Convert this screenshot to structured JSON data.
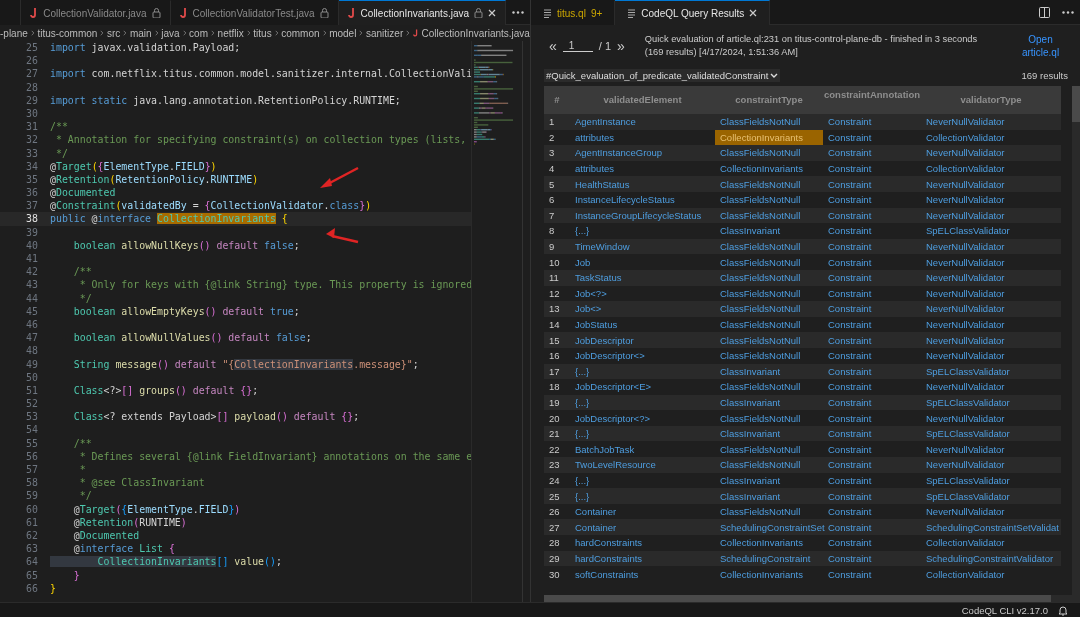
{
  "editor": {
    "tabs": [
      {
        "label": "CollectionValidator.java",
        "selected": false,
        "locked": true
      },
      {
        "label": "CollectionValidatorTest.java",
        "selected": false,
        "locked": true
      },
      {
        "label": "CollectionInvariants.java",
        "selected": true,
        "locked": true
      }
    ],
    "breadcrumb": [
      "-plane",
      "titus-common",
      "src",
      "main",
      "java",
      "com",
      "netflix",
      "titus",
      "common",
      "model",
      "sanitizer",
      "CollectionInvariants.java"
    ],
    "lines": [
      {
        "number": "25",
        "current": false,
        "tokens": [
          {
            "kind": "keyword",
            "text": "import"
          },
          {
            "kind": "plain",
            "text": " javax.validation.Payload;"
          }
        ]
      },
      {
        "number": "26",
        "current": false
      },
      {
        "number": "27",
        "current": false,
        "tokens": [
          {
            "kind": "keyword",
            "text": "import"
          },
          {
            "kind": "plain",
            "text": " com.netflix.titus.common.model.sanitizer.internal.CollectionVali"
          }
        ]
      },
      {
        "number": "28",
        "current": false
      },
      {
        "number": "29",
        "current": false,
        "tokens": [
          {
            "kind": "keyword",
            "text": "import"
          },
          {
            "kind": "keyword",
            "text": " static"
          },
          {
            "kind": "plain",
            "text": " java.lang.annotation.RetentionPolicy.RUNTIME;"
          }
        ]
      },
      {
        "number": "30",
        "current": false
      },
      {
        "number": "31",
        "current": false,
        "tokens": [
          {
            "kind": "comment",
            "text": "/**"
          }
        ]
      },
      {
        "number": "32",
        "current": false,
        "tokens": [
          {
            "kind": "comment",
            "text": " * Annotation for specifying constraint(s) on collection types (lists,"
          }
        ]
      },
      {
        "number": "33",
        "current": false,
        "tokens": [
          {
            "kind": "comment",
            "text": " */"
          }
        ]
      },
      {
        "number": "34",
        "current": false,
        "tokens": [
          {
            "kind": "plain",
            "text": "@"
          },
          {
            "kind": "type",
            "text": "Target"
          },
          {
            "kind": "bracket1",
            "text": "("
          },
          {
            "kind": "bracket2",
            "text": "{"
          },
          {
            "kind": "constant",
            "text": "ElementType"
          },
          {
            "kind": "plain",
            "text": "."
          },
          {
            "kind": "constant",
            "text": "FIELD"
          },
          {
            "kind": "bracket2",
            "text": "}"
          },
          {
            "kind": "bracket1",
            "text": ")"
          }
        ]
      },
      {
        "number": "35",
        "current": false,
        "tokens": [
          {
            "kind": "plain",
            "text": "@"
          },
          {
            "kind": "type",
            "text": "Retention"
          },
          {
            "kind": "bracket1",
            "text": "("
          },
          {
            "kind": "constant",
            "text": "RetentionPolicy"
          },
          {
            "kind": "plain",
            "text": "."
          },
          {
            "kind": "constant",
            "text": "RUNTIME"
          },
          {
            "kind": "bracket1",
            "text": ")"
          }
        ]
      },
      {
        "number": "36",
        "current": false,
        "tokens": [
          {
            "kind": "plain",
            "text": "@"
          },
          {
            "kind": "type",
            "text": "Documented"
          }
        ]
      },
      {
        "number": "37",
        "current": false,
        "tokens": [
          {
            "kind": "plain",
            "text": "@"
          },
          {
            "kind": "type",
            "text": "Constraint"
          },
          {
            "kind": "bracket1",
            "text": "("
          },
          {
            "kind": "constant",
            "text": "validatedBy"
          },
          {
            "kind": "plain",
            "text": " = "
          },
          {
            "kind": "bracket2",
            "text": "{"
          },
          {
            "kind": "constant",
            "text": "CollectionValidator"
          },
          {
            "kind": "plain",
            "text": "."
          },
          {
            "kind": "keyword",
            "text": "class"
          },
          {
            "kind": "bracket2",
            "text": "}"
          },
          {
            "kind": "bracket1",
            "text": ")"
          }
        ]
      },
      {
        "number": "38",
        "current": true,
        "tokens": [
          {
            "kind": "keyword",
            "text": "public"
          },
          {
            "kind": "plain",
            "text": " @"
          },
          {
            "kind": "keyword",
            "text": "interface "
          },
          {
            "kind": "match",
            "text": "CollectionInvariants"
          },
          {
            "kind": "bracket1",
            "text": " {"
          }
        ]
      },
      {
        "number": "39",
        "current": false
      },
      {
        "number": "40",
        "current": false,
        "tokens": [
          {
            "kind": "type",
            "text": "    boolean"
          },
          {
            "kind": "function",
            "text": " allowNullKeys"
          },
          {
            "kind": "bracket2",
            "text": "()"
          },
          {
            "kind": "control",
            "text": " default"
          },
          {
            "kind": "keyword",
            "text": " false"
          },
          {
            "kind": "plain",
            "text": ";"
          }
        ]
      },
      {
        "number": "41",
        "current": false
      },
      {
        "number": "42",
        "current": false,
        "tokens": [
          {
            "kind": "comment",
            "text": "    /**"
          }
        ]
      },
      {
        "number": "43",
        "current": false,
        "tokens": [
          {
            "kind": "comment",
            "text": "     * Only for keys with {@link String} type. This property is ignored"
          }
        ]
      },
      {
        "number": "44",
        "current": false,
        "tokens": [
          {
            "kind": "comment",
            "text": "     */"
          }
        ]
      },
      {
        "number": "45",
        "current": false,
        "tokens": [
          {
            "kind": "type",
            "text": "    boolean"
          },
          {
            "kind": "function",
            "text": " allowEmptyKeys"
          },
          {
            "kind": "bracket2",
            "text": "()"
          },
          {
            "kind": "control",
            "text": " default"
          },
          {
            "kind": "keyword",
            "text": " true"
          },
          {
            "kind": "plain",
            "text": ";"
          }
        ]
      },
      {
        "number": "46",
        "current": false
      },
      {
        "number": "47",
        "current": false,
        "tokens": [
          {
            "kind": "type",
            "text": "    boolean"
          },
          {
            "kind": "function",
            "text": " allowNullValues"
          },
          {
            "kind": "bracket2",
            "text": "()"
          },
          {
            "kind": "control",
            "text": " default"
          },
          {
            "kind": "keyword",
            "text": " false"
          },
          {
            "kind": "plain",
            "text": ";"
          }
        ]
      },
      {
        "number": "48",
        "current": false
      },
      {
        "number": "49",
        "current": false,
        "tokens": [
          {
            "kind": "type",
            "text": "    String"
          },
          {
            "kind": "function",
            "text": " message"
          },
          {
            "kind": "bracket2",
            "text": "()"
          },
          {
            "kind": "control",
            "text": " default"
          },
          {
            "kind": "string",
            "text": " \"{"
          },
          {
            "kind": "string_occurrence",
            "text": "CollectionInvariants"
          },
          {
            "kind": "string",
            "text": ".message}\""
          },
          {
            "kind": "plain",
            "text": ";"
          }
        ]
      },
      {
        "number": "50",
        "current": false
      },
      {
        "number": "51",
        "current": false,
        "tokens": [
          {
            "kind": "type",
            "text": "    Class"
          },
          {
            "kind": "plain",
            "text": "<?>"
          },
          {
            "kind": "bracket2",
            "text": "[]"
          },
          {
            "kind": "function",
            "text": " groups"
          },
          {
            "kind": "bracket2",
            "text": "()"
          },
          {
            "kind": "control",
            "text": " default"
          },
          {
            "kind": "bracket2",
            "text": " {}"
          },
          {
            "kind": "plain",
            "text": ";"
          }
        ]
      },
      {
        "number": "52",
        "current": false
      },
      {
        "number": "53",
        "current": false,
        "tokens": [
          {
            "kind": "type",
            "text": "    Class"
          },
          {
            "kind": "plain",
            "text": "<? extends Payload>"
          },
          {
            "kind": "bracket2",
            "text": "[]"
          },
          {
            "kind": "function",
            "text": " payload"
          },
          {
            "kind": "bracket2",
            "text": "()"
          },
          {
            "kind": "control",
            "text": " default"
          },
          {
            "kind": "bracket2",
            "text": " {}"
          },
          {
            "kind": "plain",
            "text": ";"
          }
        ]
      },
      {
        "number": "54",
        "current": false
      },
      {
        "number": "55",
        "current": false,
        "tokens": [
          {
            "kind": "comment",
            "text": "    /**"
          }
        ]
      },
      {
        "number": "56",
        "current": false,
        "tokens": [
          {
            "kind": "comment",
            "text": "     * Defines several {@link FieldInvariant} annotations on the same e"
          }
        ]
      },
      {
        "number": "57",
        "current": false,
        "tokens": [
          {
            "kind": "comment",
            "text": "     *"
          }
        ]
      },
      {
        "number": "58",
        "current": false,
        "tokens": [
          {
            "kind": "comment",
            "text": "     * @see ClassInvariant"
          }
        ]
      },
      {
        "number": "59",
        "current": false,
        "tokens": [
          {
            "kind": "comment",
            "text": "     */"
          }
        ]
      },
      {
        "number": "60",
        "current": false,
        "tokens": [
          {
            "kind": "plain",
            "text": "    @"
          },
          {
            "kind": "type",
            "text": "Target"
          },
          {
            "kind": "bracket2",
            "text": "("
          },
          {
            "kind": "bracket3",
            "text": "{"
          },
          {
            "kind": "constant",
            "text": "ElementType"
          },
          {
            "kind": "plain",
            "text": "."
          },
          {
            "kind": "constant",
            "text": "FIELD"
          },
          {
            "kind": "bracket3",
            "text": "}"
          },
          {
            "kind": "bracket2",
            "text": ")"
          }
        ]
      },
      {
        "number": "61",
        "current": false,
        "tokens": [
          {
            "kind": "plain",
            "text": "    @"
          },
          {
            "kind": "type",
            "text": "Retention"
          },
          {
            "kind": "bracket2",
            "text": "("
          },
          {
            "kind": "plain",
            "text": "RUNTIME"
          },
          {
            "kind": "bracket2",
            "text": ")"
          }
        ]
      },
      {
        "number": "62",
        "current": false,
        "tokens": [
          {
            "kind": "plain",
            "text": "    @"
          },
          {
            "kind": "type",
            "text": "Documented"
          }
        ]
      },
      {
        "number": "63",
        "current": false,
        "tokens": [
          {
            "kind": "plain",
            "text": "    @"
          },
          {
            "kind": "keyword",
            "text": "interface"
          },
          {
            "kind": "type",
            "text": " List"
          },
          {
            "kind": "bracket2",
            "text": " {"
          }
        ]
      },
      {
        "number": "64",
        "current": false,
        "tokens": [
          {
            "kind": "type_occurrence",
            "text": "        CollectionInvariants"
          },
          {
            "kind": "bracket3",
            "text": "[]"
          },
          {
            "kind": "function",
            "text": " value"
          },
          {
            "kind": "bracket3",
            "text": "()"
          },
          {
            "kind": "plain",
            "text": ";"
          }
        ]
      },
      {
        "number": "65",
        "current": false,
        "tokens": [
          {
            "kind": "bracket2",
            "text": "    }"
          }
        ]
      },
      {
        "number": "66",
        "current": false,
        "tokens": [
          {
            "kind": "bracket1",
            "text": "}"
          }
        ]
      }
    ]
  },
  "results": {
    "tabs": [
      {
        "label": "titus.ql",
        "badge": "9+",
        "selected": false,
        "closable": false
      },
      {
        "label": "CodeQL Query Results",
        "selected": true,
        "closable": true
      }
    ],
    "pager": {
      "first": "«",
      "page": "1",
      "total": "/ 1",
      "last": "»"
    },
    "summary": [
      "Quick evaluation of article.ql:231 on titus-control-plane-db - finished in 3 seconds",
      "(169 results) [4/17/2024, 1:51:36 AM]"
    ],
    "open_link": "Open article.ql",
    "result_set": "#Quick_evaluation_of_predicate_validatedConstraint",
    "count": "169 results",
    "columns": [
      "#",
      "validatedElement",
      "constraintType",
      "constraintAnnotation",
      "validatorType"
    ],
    "rows": [
      {
        "index": "1",
        "validatedElement": "AgentInstance",
        "constraintType": "ClassFieldsNotNull",
        "constraintType_selected": false,
        "constraintAnnotation": "Constraint",
        "validatorType": "NeverNullValidator"
      },
      {
        "index": "2",
        "validatedElement": "attributes",
        "constraintType": "CollectionInvariants",
        "constraintType_selected": true,
        "constraintAnnotation": "Constraint",
        "validatorType": "CollectionValidator"
      },
      {
        "index": "3",
        "validatedElement": "AgentInstanceGroup",
        "constraintType": "ClassFieldsNotNull",
        "constraintType_selected": false,
        "constraintAnnotation": "Constraint",
        "validatorType": "NeverNullValidator"
      },
      {
        "index": "4",
        "validatedElement": "attributes",
        "constraintType": "CollectionInvariants",
        "constraintType_selected": false,
        "constraintAnnotation": "Constraint",
        "validatorType": "CollectionValidator"
      },
      {
        "index": "5",
        "validatedElement": "HealthStatus",
        "constraintType": "ClassFieldsNotNull",
        "constraintType_selected": false,
        "constraintAnnotation": "Constraint",
        "validatorType": "NeverNullValidator"
      },
      {
        "index": "6",
        "validatedElement": "InstanceLifecycleStatus",
        "constraintType": "ClassFieldsNotNull",
        "constraintType_selected": false,
        "constraintAnnotation": "Constraint",
        "validatorType": "NeverNullValidator"
      },
      {
        "index": "7",
        "validatedElement": "InstanceGroupLifecycleStatus",
        "constraintType": "ClassFieldsNotNull",
        "constraintType_selected": false,
        "constraintAnnotation": "Constraint",
        "validatorType": "NeverNullValidator"
      },
      {
        "index": "8",
        "validatedElement": "{...}",
        "constraintType": "ClassInvariant",
        "constraintType_selected": false,
        "constraintAnnotation": "Constraint",
        "validatorType": "SpELClassValidator"
      },
      {
        "index": "9",
        "validatedElement": "TimeWindow",
        "constraintType": "ClassFieldsNotNull",
        "constraintType_selected": false,
        "constraintAnnotation": "Constraint",
        "validatorType": "NeverNullValidator"
      },
      {
        "index": "10",
        "validatedElement": "Job",
        "constraintType": "ClassFieldsNotNull",
        "constraintType_selected": false,
        "constraintAnnotation": "Constraint",
        "validatorType": "NeverNullValidator"
      },
      {
        "index": "11",
        "validatedElement": "TaskStatus",
        "constraintType": "ClassFieldsNotNull",
        "constraintType_selected": false,
        "constraintAnnotation": "Constraint",
        "validatorType": "NeverNullValidator"
      },
      {
        "index": "12",
        "validatedElement": "Job<?>",
        "constraintType": "ClassFieldsNotNull",
        "constraintType_selected": false,
        "constraintAnnotation": "Constraint",
        "validatorType": "NeverNullValidator"
      },
      {
        "index": "13",
        "validatedElement": "Job<>",
        "constraintType": "ClassFieldsNotNull",
        "constraintType_selected": false,
        "constraintAnnotation": "Constraint",
        "validatorType": "NeverNullValidator"
      },
      {
        "index": "14",
        "validatedElement": "JobStatus",
        "constraintType": "ClassFieldsNotNull",
        "constraintType_selected": false,
        "constraintAnnotation": "Constraint",
        "validatorType": "NeverNullValidator"
      },
      {
        "index": "15",
        "validatedElement": "JobDescriptor",
        "constraintType": "ClassFieldsNotNull",
        "constraintType_selected": false,
        "constraintAnnotation": "Constraint",
        "validatorType": "NeverNullValidator"
      },
      {
        "index": "16",
        "validatedElement": "JobDescriptor<>",
        "constraintType": "ClassFieldsNotNull",
        "constraintType_selected": false,
        "constraintAnnotation": "Constraint",
        "validatorType": "NeverNullValidator"
      },
      {
        "index": "17",
        "validatedElement": "{...}",
        "constraintType": "ClassInvariant",
        "constraintType_selected": false,
        "constraintAnnotation": "Constraint",
        "validatorType": "SpELClassValidator"
      },
      {
        "index": "18",
        "validatedElement": "JobDescriptor<E>",
        "constraintType": "ClassFieldsNotNull",
        "constraintType_selected": false,
        "constraintAnnotation": "Constraint",
        "validatorType": "NeverNullValidator"
      },
      {
        "index": "19",
        "validatedElement": "{...}",
        "constraintType": "ClassInvariant",
        "constraintType_selected": false,
        "constraintAnnotation": "Constraint",
        "validatorType": "SpELClassValidator"
      },
      {
        "index": "20",
        "validatedElement": "JobDescriptor<?>",
        "constraintType": "ClassFieldsNotNull",
        "constraintType_selected": false,
        "constraintAnnotation": "Constraint",
        "validatorType": "NeverNullValidator"
      },
      {
        "index": "21",
        "validatedElement": "{...}",
        "constraintType": "ClassInvariant",
        "constraintType_selected": false,
        "constraintAnnotation": "Constraint",
        "validatorType": "SpELClassValidator"
      },
      {
        "index": "22",
        "validatedElement": "BatchJobTask",
        "constraintType": "ClassFieldsNotNull",
        "constraintType_selected": false,
        "constraintAnnotation": "Constraint",
        "validatorType": "NeverNullValidator"
      },
      {
        "index": "23",
        "validatedElement": "TwoLevelResource",
        "constraintType": "ClassFieldsNotNull",
        "constraintType_selected": false,
        "constraintAnnotation": "Constraint",
        "validatorType": "NeverNullValidator"
      },
      {
        "index": "24",
        "validatedElement": "{...}",
        "constraintType": "ClassInvariant",
        "constraintType_selected": false,
        "constraintAnnotation": "Constraint",
        "validatorType": "SpELClassValidator"
      },
      {
        "index": "25",
        "validatedElement": "{...}",
        "constraintType": "ClassInvariant",
        "constraintType_selected": false,
        "constraintAnnotation": "Constraint",
        "validatorType": "SpELClassValidator"
      },
      {
        "index": "26",
        "validatedElement": "Container",
        "constraintType": "ClassFieldsNotNull",
        "constraintType_selected": false,
        "constraintAnnotation": "Constraint",
        "validatorType": "NeverNullValidator"
      },
      {
        "index": "27",
        "validatedElement": "Container",
        "constraintType": "SchedulingConstraintSet",
        "constraintType_selected": false,
        "constraintAnnotation": "Constraint",
        "validatorType": "SchedulingConstraintSetValidat"
      },
      {
        "index": "28",
        "validatedElement": "hardConstraints",
        "constraintType": "CollectionInvariants",
        "constraintType_selected": false,
        "constraintAnnotation": "Constraint",
        "validatorType": "CollectionValidator"
      },
      {
        "index": "29",
        "validatedElement": "hardConstraints",
        "constraintType": "SchedulingConstraint",
        "constraintType_selected": false,
        "constraintAnnotation": "Constraint",
        "validatorType": "SchedulingConstraintValidator"
      },
      {
        "index": "30",
        "validatedElement": "softConstraints",
        "constraintType": "CollectionInvariants",
        "constraintType_selected": false,
        "constraintAnnotation": "Constraint",
        "validatorType": "CollectionValidator"
      }
    ]
  },
  "status_bar": {
    "cli_version": "CodeQL CLI v2.17.0"
  }
}
